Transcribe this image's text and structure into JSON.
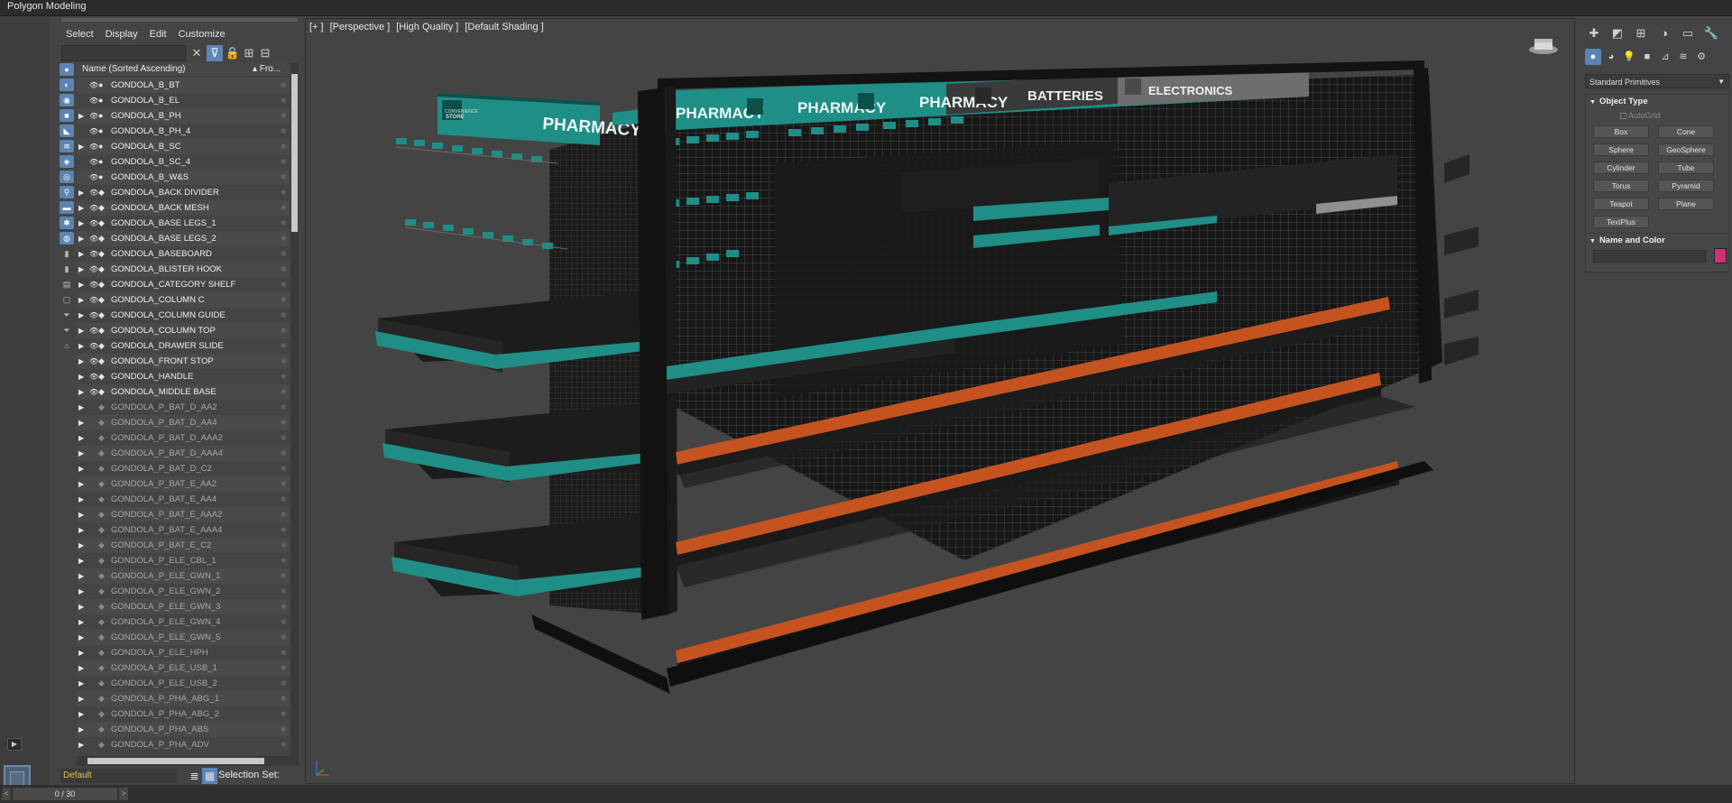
{
  "window": {
    "tab_title": "Polygon Modeling"
  },
  "menu": {
    "items": [
      "Select",
      "Display",
      "Edit",
      "Customize"
    ]
  },
  "scene_explorer": {
    "column_name": "Name (Sorted Ascending)",
    "column_frozen": "▴ Fro...",
    "rows": [
      {
        "label": "GONDOLA_B_BT",
        "arrow": false,
        "dim": false
      },
      {
        "label": "GONDOLA_B_EL",
        "arrow": false,
        "dim": false
      },
      {
        "label": "GONDOLA_B_PH",
        "arrow": true,
        "dim": false
      },
      {
        "label": "GONDOLA_B_PH_4",
        "arrow": false,
        "dim": false
      },
      {
        "label": "GONDOLA_B_SC",
        "arrow": true,
        "dim": false
      },
      {
        "label": "GONDOLA_B_SC_4",
        "arrow": false,
        "dim": false
      },
      {
        "label": "GONDOLA_B_W&S",
        "arrow": false,
        "dim": false
      },
      {
        "label": "GONDOLA_BACK DIVIDER",
        "arrow": true,
        "dim": false
      },
      {
        "label": "GONDOLA_BACK MESH",
        "arrow": true,
        "dim": false
      },
      {
        "label": "GONDOLA_BASE LEGS_1",
        "arrow": true,
        "dim": false
      },
      {
        "label": "GONDOLA_BASE LEGS_2",
        "arrow": true,
        "dim": false
      },
      {
        "label": "GONDOLA_BASEBOARD",
        "arrow": true,
        "dim": false
      },
      {
        "label": "GONDOLA_BLISTER HOOK",
        "arrow": true,
        "dim": false
      },
      {
        "label": "GONDOLA_CATEGORY SHELF",
        "arrow": true,
        "dim": false
      },
      {
        "label": "GONDOLA_COLUMN C",
        "arrow": true,
        "dim": false
      },
      {
        "label": "GONDOLA_COLUMN GUIDE",
        "arrow": true,
        "dim": false
      },
      {
        "label": "GONDOLA_COLUMN TOP",
        "arrow": true,
        "dim": false
      },
      {
        "label": "GONDOLA_DRAWER SLIDE",
        "arrow": true,
        "dim": false
      },
      {
        "label": "GONDOLA_FRONT STOP",
        "arrow": true,
        "dim": false
      },
      {
        "label": "GONDOLA_HANDLE",
        "arrow": true,
        "dim": false
      },
      {
        "label": "GONDOLA_MIDDLE BASE",
        "arrow": true,
        "dim": false
      },
      {
        "label": "GONDOLA_P_BAT_D_AA2",
        "arrow": true,
        "dim": true
      },
      {
        "label": "GONDOLA_P_BAT_D_AA4",
        "arrow": true,
        "dim": true
      },
      {
        "label": "GONDOLA_P_BAT_D_AAA2",
        "arrow": true,
        "dim": true
      },
      {
        "label": "GONDOLA_P_BAT_D_AAA4",
        "arrow": true,
        "dim": true
      },
      {
        "label": "GONDOLA_P_BAT_D_C2",
        "arrow": true,
        "dim": true
      },
      {
        "label": "GONDOLA_P_BAT_E_AA2",
        "arrow": true,
        "dim": true
      },
      {
        "label": "GONDOLA_P_BAT_E_AA4",
        "arrow": true,
        "dim": true
      },
      {
        "label": "GONDOLA_P_BAT_E_AAA2",
        "arrow": true,
        "dim": true
      },
      {
        "label": "GONDOLA_P_BAT_E_AAA4",
        "arrow": true,
        "dim": true
      },
      {
        "label": "GONDOLA_P_BAT_E_C2",
        "arrow": true,
        "dim": true
      },
      {
        "label": "GONDOLA_P_ELE_CBL_1",
        "arrow": true,
        "dim": true
      },
      {
        "label": "GONDOLA_P_ELE_GWN_1",
        "arrow": true,
        "dim": true
      },
      {
        "label": "GONDOLA_P_ELE_GWN_2",
        "arrow": true,
        "dim": true
      },
      {
        "label": "GONDOLA_P_ELE_GWN_3",
        "arrow": true,
        "dim": true
      },
      {
        "label": "GONDOLA_P_ELE_GWN_4",
        "arrow": true,
        "dim": true
      },
      {
        "label": "GONDOLA_P_ELE_GWN_5",
        "arrow": true,
        "dim": true
      },
      {
        "label": "GONDOLA_P_ELE_HPH",
        "arrow": true,
        "dim": true
      },
      {
        "label": "GONDOLA_P_ELE_USB_1",
        "arrow": true,
        "dim": true
      },
      {
        "label": "GONDOLA_P_ELE_USB_2",
        "arrow": true,
        "dim": true
      },
      {
        "label": "GONDOLA_P_PHA_ABG_1",
        "arrow": true,
        "dim": true
      },
      {
        "label": "GONDOLA_P_PHA_ABG_2",
        "arrow": true,
        "dim": true
      },
      {
        "label": "GONDOLA_P_PHA_ABS",
        "arrow": true,
        "dim": true
      },
      {
        "label": "GONDOLA_P_PHA_ADV",
        "arrow": true,
        "dim": true
      }
    ]
  },
  "layer_bar": {
    "current_layer": "Default",
    "selection_set_label": "Selection Set:"
  },
  "viewport": {
    "labels": [
      "[+ ]",
      "[Perspective ]",
      "[High Quality ]",
      "[Default Shading ]"
    ],
    "signs": {
      "pharmacy": "PHARMACY",
      "batteries": "BATTERIES",
      "electronics": "ELECTRONICS",
      "store_logo_top": "CONVENIENCE",
      "store_logo_bottom": "STORE"
    },
    "colors": {
      "teal": "#1f8e86",
      "orange": "#c5531f",
      "dark_metal": "#1c1c1c",
      "sign_grey": "#6e6e6e"
    }
  },
  "command_panel": {
    "category": "Standard Primitives",
    "object_type_title": "Object Type",
    "autogrid": "AutoGrid",
    "primitives": [
      "Box",
      "Cone",
      "Sphere",
      "GeoSphere",
      "Cylinder",
      "Tube",
      "Torus",
      "Pyramid",
      "Teapot",
      "Plane",
      "TextPlus"
    ],
    "name_color_title": "Name and Color",
    "object_color": "#d0307b"
  },
  "status": {
    "frame_range": "0 / 30"
  }
}
